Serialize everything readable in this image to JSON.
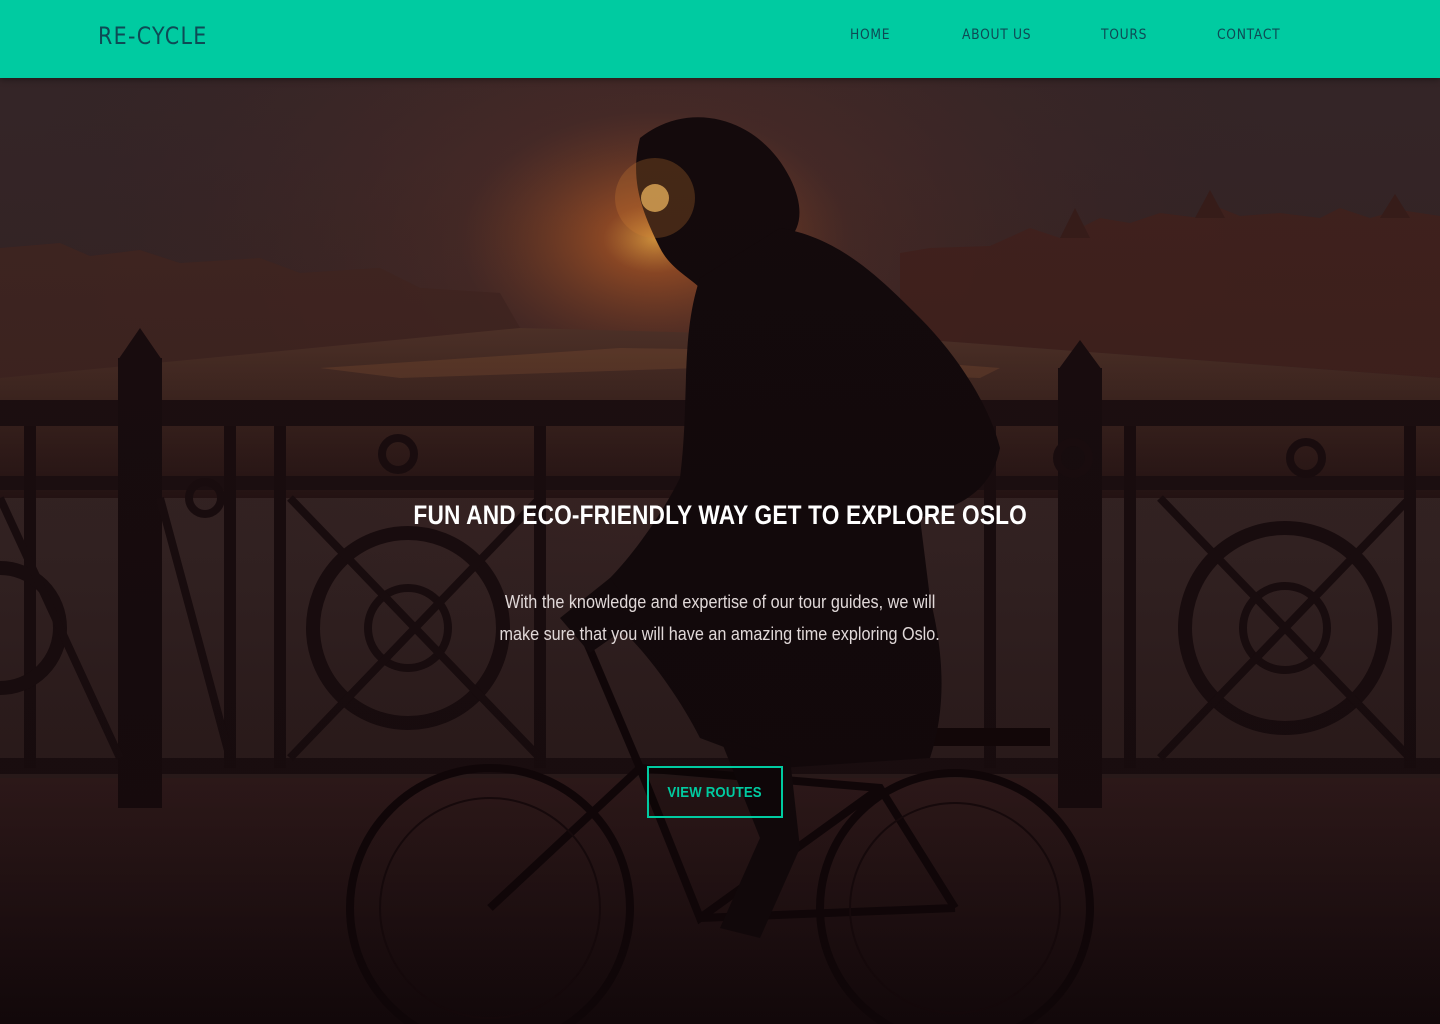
{
  "navbar": {
    "brand": "RE-CYCLE",
    "links": [
      {
        "label": "HOME"
      },
      {
        "label": "ABOUT US"
      },
      {
        "label": "TOURS"
      },
      {
        "label": "CONTACT"
      }
    ],
    "background_color": "#00cba1",
    "text_color": "#0e4a55"
  },
  "hero": {
    "background_image": "cyclist-on-bridge-at-sunset",
    "title": "FUN AND ECO-FRIENDLY WAY GET TO EXPLORE OSLO",
    "text_line1": "With the knowledge and expertise of our tour guides, we will",
    "text_line2": "make sure that you will have an amazing time exploring Oslo.",
    "cta_label": "VIEW ROUTES",
    "accent_color": "#00cba1"
  }
}
